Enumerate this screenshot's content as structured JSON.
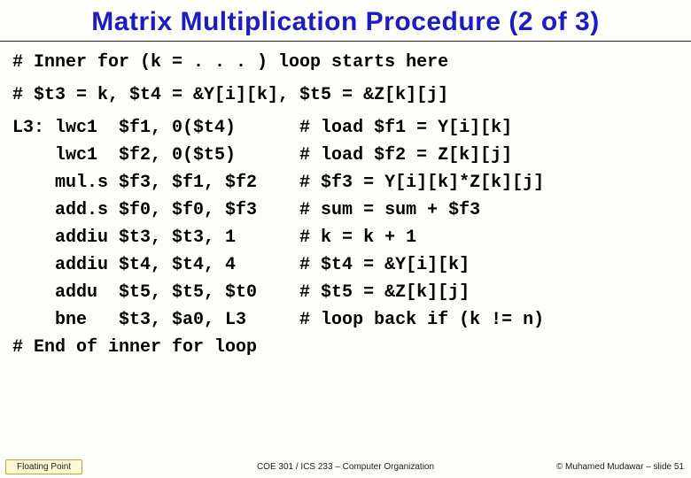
{
  "title": "Matrix Multiplication Procedure (2 of 3)",
  "lines": {
    "c1": "# Inner for (k = . . . ) loop starts here",
    "c2": "# $t3 = k, $t4 = &Y[i][k], $t5 = &Z[k][j]",
    "l1": "L3: lwc1  $f1, 0($t4)      # load $f1 = Y[i][k]",
    "l2": "    lwc1  $f2, 0($t5)      # load $f2 = Z[k][j]",
    "l3": "    mul.s $f3, $f1, $f2    # $f3 = Y[i][k]*Z[k][j]",
    "l4": "    add.s $f0, $f0, $f3    # sum = sum + $f3",
    "l5": "    addiu $t3, $t3, 1      # k = k + 1",
    "l6": "    addiu $t4, $t4, 4      # $t4 = &Y[i][k]",
    "l7": "    addu  $t5, $t5, $t0    # $t5 = &Z[k][j]",
    "l8": "    bne   $t3, $a0, L3     # loop back if (k != n)",
    "c3": "# End of inner for loop"
  },
  "footer": {
    "left": "Floating Point",
    "center": "COE 301 / ICS 233 – Computer Organization",
    "right": "© Muhamed Mudawar – slide 51"
  }
}
